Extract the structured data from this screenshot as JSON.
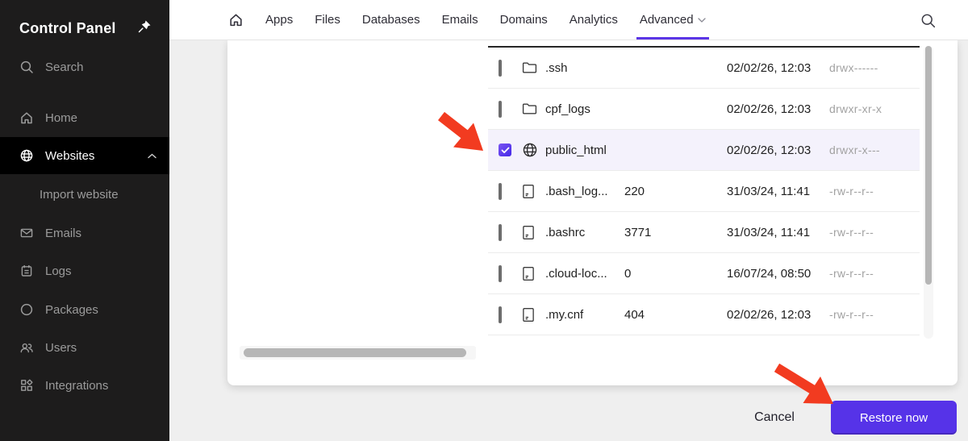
{
  "sidebar": {
    "title": "Control Panel",
    "items": [
      {
        "label": "Search",
        "icon": "search-icon"
      },
      {
        "label": "Home",
        "icon": "home-icon"
      },
      {
        "label": "Websites",
        "icon": "globe-icon",
        "active": true,
        "expanded": true
      },
      {
        "label": "Import website",
        "sub": true
      },
      {
        "label": "Emails",
        "icon": "mail-icon"
      },
      {
        "label": "Logs",
        "icon": "logs-icon"
      },
      {
        "label": "Packages",
        "icon": "packages-icon"
      },
      {
        "label": "Users",
        "icon": "users-icon"
      },
      {
        "label": "Integrations",
        "icon": "integrations-icon"
      }
    ]
  },
  "header": {
    "nav": [
      {
        "label": "Apps"
      },
      {
        "label": "Files"
      },
      {
        "label": "Databases"
      },
      {
        "label": "Emails"
      },
      {
        "label": "Domains"
      },
      {
        "label": "Analytics"
      },
      {
        "label": "Advanced",
        "active": true,
        "has_dropdown": true
      }
    ],
    "search_icon": "search-icon"
  },
  "table": {
    "rows": [
      {
        "type": "folder",
        "name": ".ssh",
        "size": "",
        "modified": "02/02/26, 12:03",
        "permissions": "drwx------",
        "checked": false
      },
      {
        "type": "folder",
        "name": "cpf_logs",
        "size": "",
        "modified": "02/02/26, 12:03",
        "permissions": "drwxr-xr-x",
        "checked": false
      },
      {
        "type": "globe",
        "name": "public_html",
        "size": "",
        "modified": "02/02/26, 12:03",
        "permissions": "drwxr-x---",
        "checked": true
      },
      {
        "type": "file",
        "name": ".bash_log...",
        "size": "220",
        "modified": "31/03/24, 11:41",
        "permissions": "-rw-r--r--",
        "checked": false
      },
      {
        "type": "file",
        "name": ".bashrc",
        "size": "3771",
        "modified": "31/03/24, 11:41",
        "permissions": "-rw-r--r--",
        "checked": false
      },
      {
        "type": "file",
        "name": ".cloud-loc...",
        "size": "0",
        "modified": "16/07/24, 08:50",
        "permissions": "-rw-r--r--",
        "checked": false
      },
      {
        "type": "file",
        "name": ".my.cnf",
        "size": "404",
        "modified": "02/02/26, 12:03",
        "permissions": "-rw-r--r--",
        "checked": false
      }
    ]
  },
  "footer": {
    "cancel_label": "Cancel",
    "restore_label": "Restore now"
  },
  "colors": {
    "accent_purple": "#5b35e6",
    "button_purple": "#5633e8",
    "checkbox_purple": "#4529e8",
    "arrow_red": "#f23b20",
    "row_highlight": "#f4f2fc",
    "sidebar_bg": "#1d1c1c",
    "sidebar_active_bg": "#000000"
  }
}
